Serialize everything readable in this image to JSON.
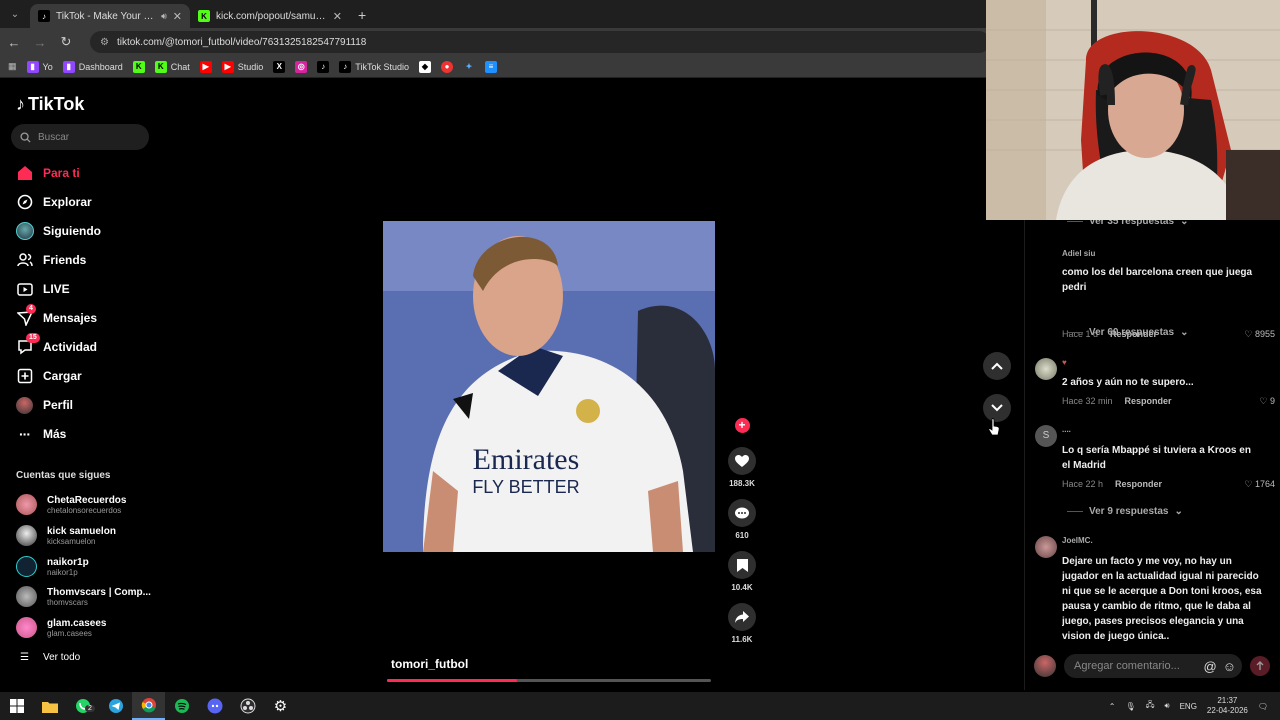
{
  "browser": {
    "tabs": [
      {
        "title": "TikTok - Make Your Day",
        "active": true
      },
      {
        "title": "kick.com/popout/samuelon/chat",
        "active": false
      }
    ],
    "url": "tiktok.com/@tomori_futbol/video/7631325182547791118",
    "bookmarks": [
      "Yo",
      "Dashboard",
      "Chat",
      "Studio",
      "TikTok Studio"
    ]
  },
  "tiktok": {
    "logo": "TikTok",
    "search_placeholder": "Buscar",
    "nav": [
      {
        "label": "Para ti",
        "icon": "home-icon",
        "active": true
      },
      {
        "label": "Explorar",
        "icon": "compass-icon"
      },
      {
        "label": "Siguiendo",
        "icon": "following-avatar-icon"
      },
      {
        "label": "Friends",
        "icon": "friends-icon"
      },
      {
        "label": "LIVE",
        "icon": "live-icon"
      },
      {
        "label": "Mensajes",
        "icon": "messages-icon",
        "badge": "4"
      },
      {
        "label": "Actividad",
        "icon": "activity-icon",
        "badge": "15"
      },
      {
        "label": "Cargar",
        "icon": "upload-icon"
      },
      {
        "label": "Perfil",
        "icon": "profile-icon"
      },
      {
        "label": "Más",
        "icon": "more-icon"
      }
    ],
    "following_title": "Cuentas que sigues",
    "following": [
      {
        "name": "ChetaRecuerdos",
        "user": "chetalonsorecuerdos"
      },
      {
        "name": "kick samuelon",
        "user": "kicksamuelon"
      },
      {
        "name": "naikor1p",
        "user": "naikor1p"
      },
      {
        "name": "Thomvscars | Comp...",
        "user": "thomvscars"
      },
      {
        "name": "glam.casees",
        "user": "glam.casees"
      }
    ],
    "see_all": "Ver todo"
  },
  "video": {
    "author": "tomori_futbol",
    "progress_fraction": 0.4,
    "shirt_text_1": "Emirates",
    "shirt_text_2": "FLY BETTER",
    "likes": "188.3K",
    "comments": "610",
    "saves": "10.4K",
    "shares": "11.6K"
  },
  "comments": {
    "top_replies": "Ver 35 respuestas",
    "items": [
      {
        "user": "Adiel siu",
        "text": "como los del barcelona creen que juega pedri",
        "time": "Hace 1 d",
        "reply": "Responder",
        "likes": "8955",
        "replies": "Ver 60 respuestas"
      },
      {
        "user": "",
        "text": "2 años y aún no te supero...",
        "time": "Hace 32 min",
        "reply": "Responder",
        "likes": "9"
      },
      {
        "user": "....",
        "avatar_letter": "S",
        "text": "Lo q sería Mbappé si tuviera a Kroos en el Madrid",
        "time": "Hace 22 h",
        "reply": "Responder",
        "likes": "1764",
        "replies": "Ver 9 respuestas"
      },
      {
        "user": "JoelMC.",
        "text": "Dejare un facto y me voy, no hay un jugador en la actualidad igual ni parecido ni que se le acerque a Don toni kroos, esa pausa y cambio de ritmo, que le daba al juego, pases precisos elegancia y una vision de juego única.."
      }
    ],
    "add_placeholder": "Agregar comentario..."
  },
  "taskbar": {
    "lang": "ENG",
    "time": "21:37",
    "date": "22-04-2026",
    "whatsapp_badge": "2"
  }
}
